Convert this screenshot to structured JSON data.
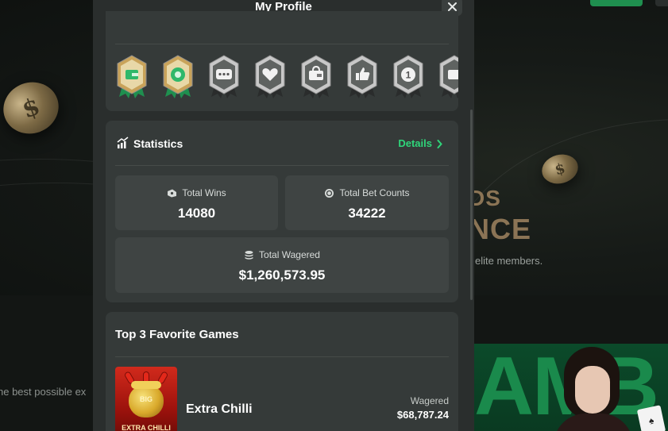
{
  "background": {
    "headline_line1": "DS",
    "headline_line2": "NCE",
    "subtext": "elite members.",
    "lower_text": "he best possible ex",
    "banner_letters": "AMB",
    "card_glyph": "♠"
  },
  "modal": {
    "title": "My Profile",
    "close_label": "✕"
  },
  "badges": [
    {
      "icon": "wallet-badge-icon",
      "style": "gold"
    },
    {
      "icon": "chip-badge-icon",
      "style": "gold"
    },
    {
      "icon": "chat-badge-icon",
      "style": "silver"
    },
    {
      "icon": "heart-badge-icon",
      "style": "silver"
    },
    {
      "icon": "wallet-lock-badge-icon",
      "style": "silver"
    },
    {
      "icon": "thumbs-up-badge-icon",
      "style": "silver"
    },
    {
      "icon": "number-one-badge-icon",
      "style": "silver",
      "text": "1"
    },
    {
      "icon": "partial-badge-icon",
      "style": "silver"
    }
  ],
  "statistics": {
    "title": "Statistics",
    "details_label": "Details",
    "total_wins": {
      "label": "Total Wins",
      "value": "14080"
    },
    "total_bet_counts": {
      "label": "Total Bet Counts",
      "value": "34222"
    },
    "total_wagered": {
      "label": "Total Wagered",
      "value": "$1,260,573.95"
    }
  },
  "favorites": {
    "title": "Top 3 Favorite Games",
    "games": [
      {
        "name": "Extra Chilli",
        "thumb_badge": "BIG",
        "thumb_text": "EXTRA CHILLI",
        "wagered_label": "Wagered",
        "wagered_value": "$68,787.24"
      }
    ]
  },
  "colors": {
    "accent_green": "#2fd57a",
    "modal_bg": "#2a2e2d",
    "card_bg": "#353a39",
    "stat_box_bg": "#3f4443"
  }
}
